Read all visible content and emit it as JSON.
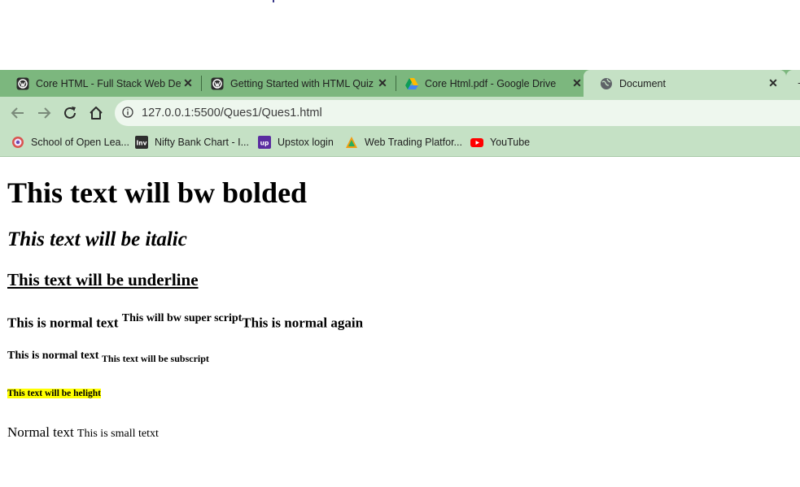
{
  "browser": {
    "tabs": [
      {
        "title": "Core HTML - Full Stack Web Deve",
        "icon": "site-favicon",
        "active": false
      },
      {
        "title": "Getting Started with HTML Quiz",
        "icon": "site-favicon",
        "active": false
      },
      {
        "title": "Core Html.pdf - Google Drive",
        "icon": "google-drive-icon",
        "active": false
      },
      {
        "title": "Document",
        "icon": "globe-icon",
        "active": true
      }
    ],
    "close_glyph": "✕",
    "new_tab_glyph": "+",
    "address": "127.0.0.1:5500/Ques1/Ques1.html",
    "bookmarks": [
      {
        "label": "School of Open Lea...",
        "icon": "school-icon"
      },
      {
        "label": "Nifty Bank Chart - I...",
        "icon": "investing-icon"
      },
      {
        "label": "Upstox login",
        "icon": "upstox-icon"
      },
      {
        "label": "Web Trading Platfor...",
        "icon": "trading-icon"
      },
      {
        "label": "YouTube",
        "icon": "youtube-icon"
      }
    ],
    "colors": {
      "frame": "#7cb77e",
      "toolbar": "#c5e1c5",
      "omnibox": "#eef7ee"
    }
  },
  "page": {
    "h1": "This text will bw bolded",
    "h2": "This text will be italic",
    "h3": "This text will be underline",
    "h4_normal": "This is normal text ",
    "h4_sup": "This will bw super script",
    "h4_normal_again": "This is normal again",
    "h5_normal": "This is normal text ",
    "h5_sub": "This text will be subscript",
    "h6_mark": "This text will be helight",
    "p_normal": "Normal text ",
    "p_small": "This is small tetxt",
    "highlight_color": "#ffff00"
  }
}
